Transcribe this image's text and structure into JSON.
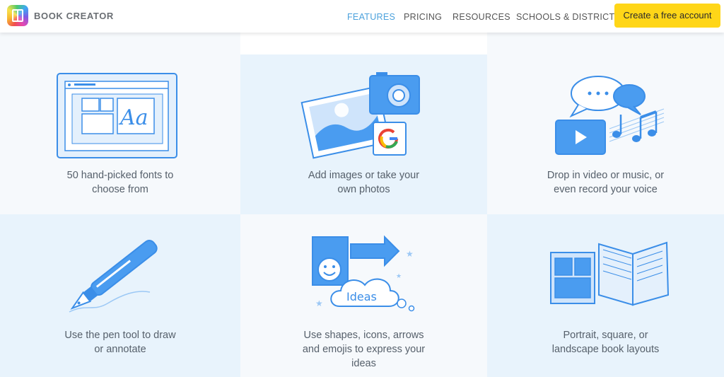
{
  "header": {
    "brand": "BOOK CREATOR",
    "nav": [
      {
        "label": "FEATURES",
        "active": true
      },
      {
        "label": "PRICING",
        "active": false
      },
      {
        "label": "RESOURCES",
        "active": false
      },
      {
        "label": "SCHOOLS & DISTRICTS",
        "active": false
      }
    ],
    "cta_label": "Create a free account"
  },
  "features": [
    {
      "caption_line1": "50 hand-picked fonts to",
      "caption_line2": "choose from",
      "icon": "fonts-window-icon",
      "icon_text": "Aa"
    },
    {
      "caption_line1": "Add images or take your",
      "caption_line2": "own photos",
      "icon": "images-camera-google-icon"
    },
    {
      "caption_line1": "Drop in video or music, or",
      "caption_line2": "even record your voice",
      "icon": "media-chat-music-icon"
    },
    {
      "caption_line1": "Use the pen tool to draw",
      "caption_line2": "or annotate",
      "icon": "fountain-pen-icon"
    },
    {
      "caption_line1": "Use shapes, icons, arrows",
      "caption_line2": "and emojis to express your",
      "caption_line3": "ideas",
      "icon": "shapes-ideas-cloud-icon",
      "icon_text": "Ideas"
    },
    {
      "caption_line1": "Portrait, square, or",
      "caption_line2": "landscape book layouts",
      "icon": "book-layouts-icon"
    }
  ],
  "colors": {
    "accent": "#4ba1dc",
    "cta": "#ffd618",
    "icon_blue": "#3b8ee8",
    "icon_light": "#cfe4fb"
  }
}
